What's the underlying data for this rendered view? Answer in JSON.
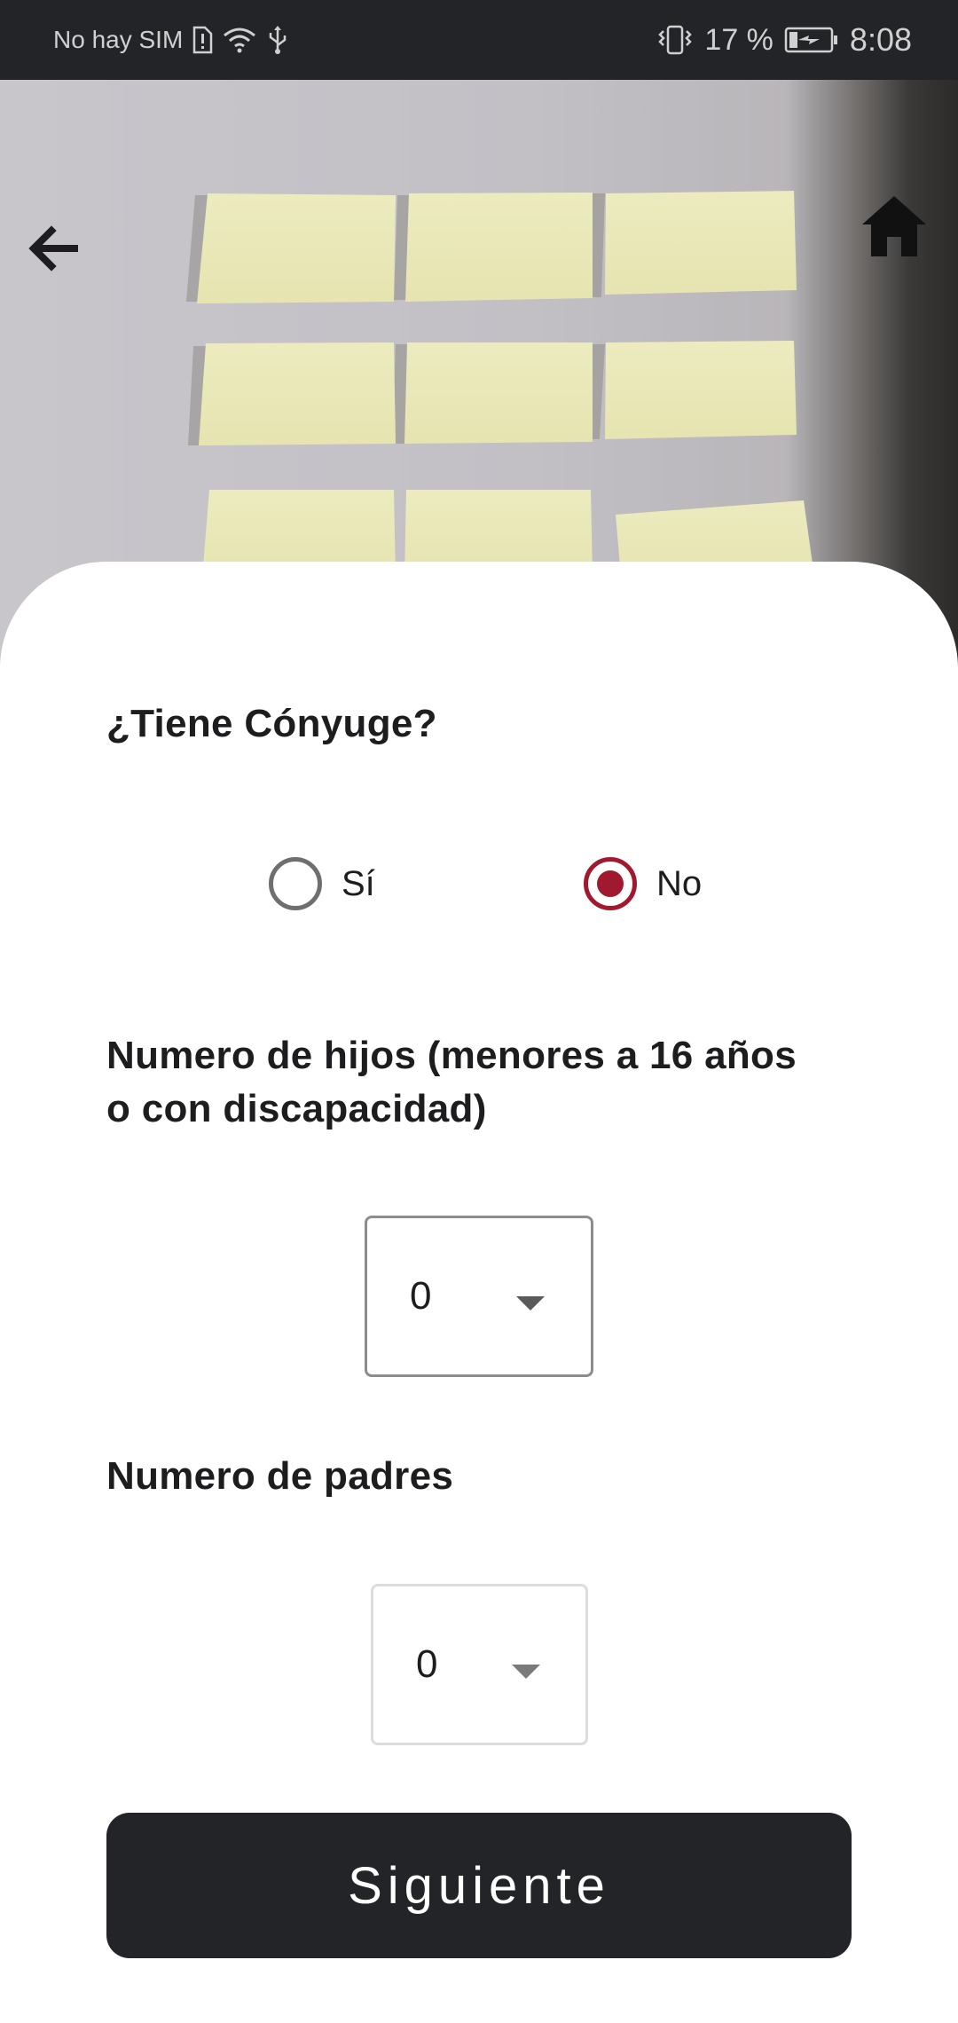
{
  "status_bar": {
    "carrier": "No hay SIM",
    "battery_percent": "17 %",
    "time": "8:08",
    "icons": [
      "sim-alert-icon",
      "wifi-icon",
      "usb-icon",
      "vibrate-icon",
      "battery-charging-icon"
    ]
  },
  "header": {
    "back_icon": "arrow-left-icon",
    "home_icon": "home-icon"
  },
  "form": {
    "spouse_question": "¿Tiene Cónyuge?",
    "spouse_options": [
      {
        "label": "Sí",
        "selected": false
      },
      {
        "label": "No",
        "selected": true
      }
    ],
    "children_question": "Numero de hijos (menores a 16 años o con discapacidad)",
    "children_value": "0",
    "parents_question": "Numero de padres",
    "parents_value": "0"
  },
  "actions": {
    "next_label": "Siguiente"
  },
  "colors": {
    "accent": "#a1192f",
    "dark": "#232427",
    "note": "#ecebb8"
  }
}
